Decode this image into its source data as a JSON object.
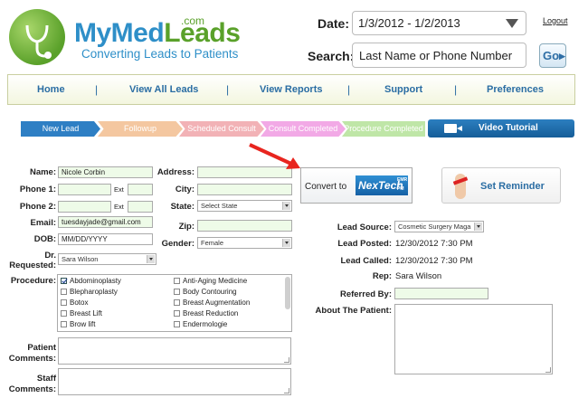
{
  "brand": {
    "name_part1": "MyMed",
    "name_part2": "Leads",
    "com": ".com",
    "tagline": "Converting Leads to Patients"
  },
  "header": {
    "date_label": "Date:",
    "date_value": "1/3/2012 - 1/2/2013",
    "logout": "Logout",
    "search_label": "Search:",
    "search_placeholder": "Last Name or Phone Number",
    "go": "Go"
  },
  "nav": {
    "items": [
      "Home",
      "View All Leads",
      "View Reports",
      "Support",
      "Preferences"
    ],
    "separator": "|"
  },
  "progress": {
    "steps": [
      {
        "label": "New Lead",
        "color": "#2e7fc4"
      },
      {
        "label": "Followup",
        "color": "#f4c7a0"
      },
      {
        "label": "Scheduled Consult",
        "color": "#f2b2b6"
      },
      {
        "label": "Consult Completed",
        "color": "#f2a9e6"
      },
      {
        "label": "Procedure Completed",
        "color": "#bfe6a7"
      }
    ],
    "video_tutorial": "Video Tutorial"
  },
  "form": {
    "name_label": "Name:",
    "name_value": "Nicole Corbin",
    "phone1_label": "Phone 1:",
    "phone2_label": "Phone 2:",
    "ext_label": "Ext",
    "email_label": "Email:",
    "email_value": "tuesdayjade@gmail.com",
    "dob_label": "DOB:",
    "dob_value": "MM/DD/YYYY",
    "dr_label_1": "Dr.",
    "dr_label_2": "Requested:",
    "dr_value": "Sara Wilson",
    "procedure_label": "Procedure:",
    "procedures_left": [
      {
        "label": "Abdominoplasty",
        "checked": true
      },
      {
        "label": "Blepharoplasty",
        "checked": false
      },
      {
        "label": "Botox",
        "checked": false
      },
      {
        "label": "Breast Lift",
        "checked": false
      },
      {
        "label": "Brow lift",
        "checked": false
      }
    ],
    "procedures_right": [
      {
        "label": "Anti-Aging Medicine",
        "checked": false
      },
      {
        "label": "Body Contouring",
        "checked": false
      },
      {
        "label": "Breast Augmentation",
        "checked": false
      },
      {
        "label": "Breast Reduction",
        "checked": false
      },
      {
        "label": "Endermologie",
        "checked": false
      }
    ],
    "patient_comments_1": "Patient",
    "patient_comments_2": "Comments:",
    "staff_comments_1": "Staff",
    "staff_comments_2": "Comments:",
    "address_label": "Address:",
    "city_label": "City:",
    "state_label": "State:",
    "state_value": "Select State",
    "zip_label": "Zip:",
    "gender_label": "Gender:",
    "gender_value": "Female"
  },
  "actions": {
    "convert_to": "Convert to",
    "nextech": "NexTech",
    "nextech_sub": "EMR & PM",
    "set_reminder": "Set Reminder"
  },
  "details": {
    "lead_source_label": "Lead Source:",
    "lead_source_value": "Cosmetic Surgery Maga",
    "lead_posted_label": "Lead Posted:",
    "lead_posted_value": "12/30/2012 7:30 PM",
    "lead_called_label": "Lead Called:",
    "lead_called_value": "12/30/2012 7:30 PM",
    "rep_label": "Rep:",
    "rep_value": "Sara Wilson",
    "referred_by_label": "Referred By:",
    "about_label": "About The Patient:"
  }
}
